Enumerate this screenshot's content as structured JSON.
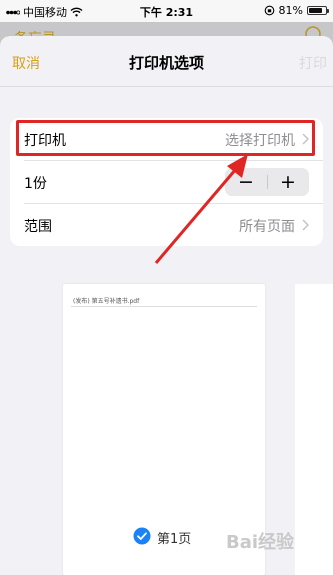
{
  "status_bar": {
    "carrier": "中国移动",
    "time": "下午 2:31",
    "battery_percent": "81%",
    "battery_level": 0.81
  },
  "background_app": {
    "back_label": "备忘录"
  },
  "nav": {
    "cancel_label": "取消",
    "title": "打印机选项",
    "print_label": "打印"
  },
  "options": {
    "printer": {
      "label": "打印机",
      "value": "选择打印机"
    },
    "copies": {
      "label": "1份",
      "minus": "−",
      "plus": "+"
    },
    "range": {
      "label": "范围",
      "value": "所有页面"
    }
  },
  "preview": {
    "doc_title": "(发布) 第五号补遗书.pdf",
    "page_label": "第1页",
    "page_selected": true
  },
  "watermark": {
    "text": "Bai经验"
  },
  "colors": {
    "accent": "#d4a017",
    "highlight": "#e02525",
    "check": "#1a82f7"
  }
}
